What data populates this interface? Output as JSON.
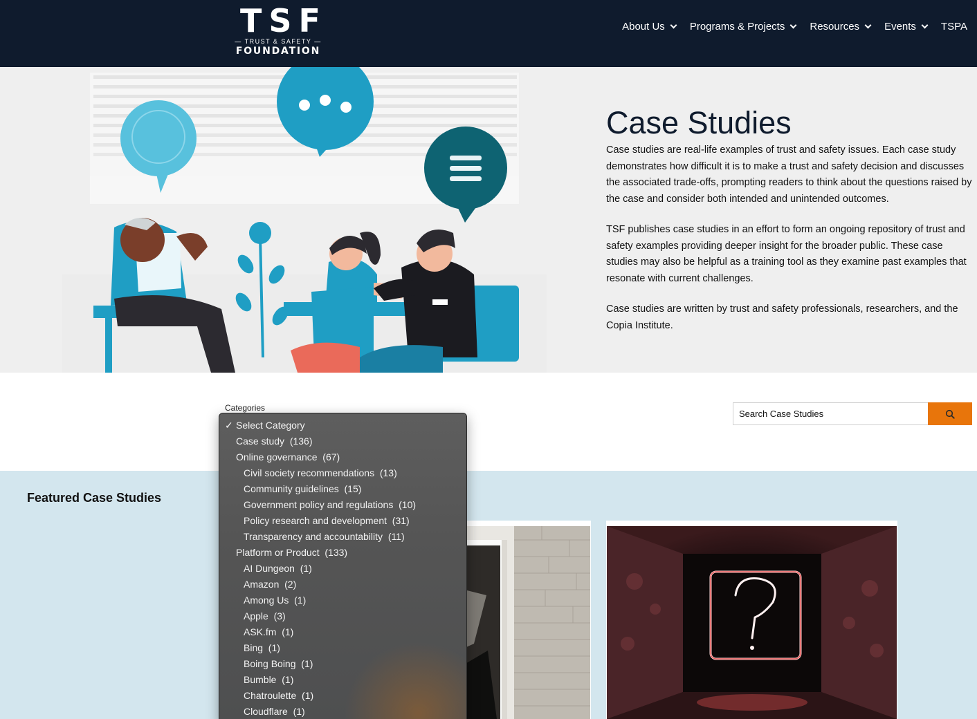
{
  "header": {
    "logo": {
      "mark": "TSF",
      "tagline": "— TRUST & SAFETY —",
      "name": "FOUNDATION"
    },
    "nav": [
      {
        "label": "About Us",
        "has_dropdown": true
      },
      {
        "label": "Programs & Projects",
        "has_dropdown": true
      },
      {
        "label": "Resources",
        "has_dropdown": true
      },
      {
        "label": "Events",
        "has_dropdown": true
      },
      {
        "label": "TSPA",
        "has_dropdown": false
      }
    ]
  },
  "hero": {
    "title": "Case Studies",
    "paragraphs": [
      "Case studies are real-life examples of trust and safety issues. Each case study demonstrates how difficult it is to make a trust and safety decision and discusses the associated trade-offs, prompting readers to think about the questions raised by the case and consider both intended and unintended outcomes.",
      "TSF publishes case studies in an effort to form an ongoing repository of trust and safety examples providing deeper insight for the broader public. These case studies may also be helpful as a training tool as they examine past examples that resonate with current challenges.",
      "Case studies are written by trust and safety professionals, researchers, and the Copia Institute."
    ]
  },
  "filters": {
    "categories_label": "Categories",
    "search_placeholder": "Search Case Studies",
    "search_icon": "search-icon",
    "accent_color": "#e8750b"
  },
  "categories_dropdown": {
    "selected_mark": "✓",
    "options": [
      {
        "label": "Select Category",
        "level": 0,
        "selected": true
      },
      {
        "label": "Case study  (136)",
        "level": 0
      },
      {
        "label": "Online governance  (67)",
        "level": 0
      },
      {
        "label": "Civil society recommendations  (13)",
        "level": 1
      },
      {
        "label": "Community guidelines  (15)",
        "level": 1
      },
      {
        "label": "Government policy and regulations  (10)",
        "level": 1
      },
      {
        "label": "Policy research and development  (31)",
        "level": 1
      },
      {
        "label": "Transparency and accountability  (11)",
        "level": 1
      },
      {
        "label": "Platform or Product  (133)",
        "level": 0
      },
      {
        "label": "AI Dungeon  (1)",
        "level": 1
      },
      {
        "label": "Amazon  (2)",
        "level": 1
      },
      {
        "label": "Among Us  (1)",
        "level": 1
      },
      {
        "label": "Apple  (3)",
        "level": 1
      },
      {
        "label": "ASK.fm  (1)",
        "level": 1
      },
      {
        "label": "Bing  (1)",
        "level": 1
      },
      {
        "label": "Boing Boing  (1)",
        "level": 1
      },
      {
        "label": "Bumble  (1)",
        "level": 1
      },
      {
        "label": "Chatroulette  (1)",
        "level": 1
      },
      {
        "label": "Cloudflare  (1)",
        "level": 1
      }
    ]
  },
  "featured": {
    "title": "Featured Case Studies"
  },
  "colors": {
    "header_bg": "#0f1b2d",
    "hero_bg": "#efefef",
    "featured_bg": "#d3e6ee",
    "illustration_blue": "#1f9ec4",
    "illustration_teal": "#0e6372"
  }
}
